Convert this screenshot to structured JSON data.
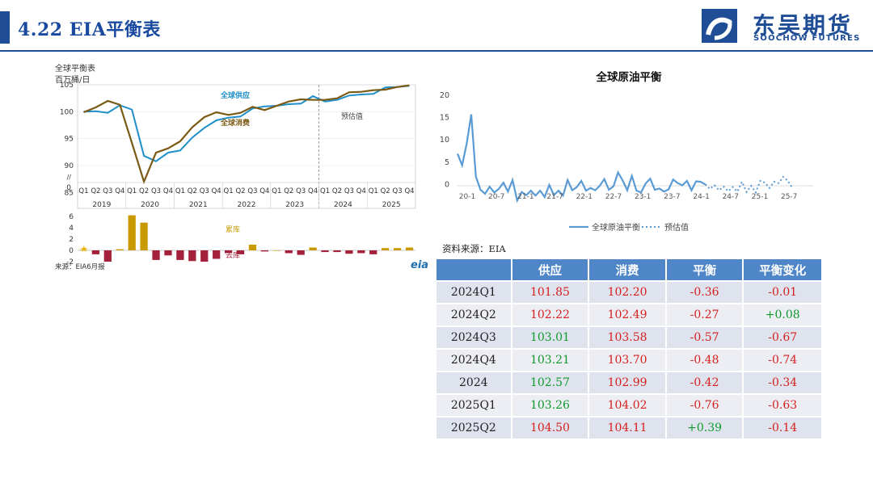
{
  "header": {
    "title": "4.22 EIA平衡表",
    "logo_cn": "东吴期货",
    "logo_en": "SOOCHOW FUTURES"
  },
  "colors": {
    "brand": "#1f4e96",
    "supply": "#1f8fc8",
    "consumption": "#7b5a14",
    "build": "#c99a00",
    "draw": "#a3213a",
    "balance_line": "#5b9bd5",
    "table_header": "#4e86c8",
    "positive": "#0f9a2e",
    "negative": "#d61f1f"
  },
  "left_chart": {
    "title": "全球平衡表",
    "unit": "百万桶/日",
    "supply_label": "全球供应",
    "consumption_label": "全球消费",
    "forecast_label": "预估值",
    "build_label": "累库",
    "draw_label": "去库",
    "source": "来源：EIA6月报",
    "eia_logo": "eia",
    "axis_break": "//",
    "quarters": [
      "Q1",
      "Q2",
      "Q3",
      "Q4",
      "Q1",
      "Q2",
      "Q3",
      "Q4",
      "Q1",
      "Q2",
      "Q3",
      "Q4",
      "Q1",
      "Q2",
      "Q3",
      "Q4",
      "Q1",
      "Q2",
      "Q3",
      "Q4",
      "Q1",
      "Q2",
      "Q3",
      "Q4",
      "Q1",
      "Q2",
      "Q3",
      "Q4"
    ],
    "years": [
      "2019",
      "2020",
      "2021",
      "2022",
      "2023",
      "2024",
      "2025"
    ],
    "y_ticks": [
      "105",
      "100",
      "95",
      "90",
      "85",
      "//",
      "0"
    ],
    "bar_ticks": [
      "6",
      "4",
      "2",
      "0",
      "-2"
    ]
  },
  "chart_data": [
    {
      "type": "line",
      "title": "全球平衡表",
      "ylabel": "百万桶/日",
      "ylim": [
        84,
        105
      ],
      "categories": [
        "2019Q1",
        "2019Q2",
        "2019Q3",
        "2019Q4",
        "2020Q1",
        "2020Q2",
        "2020Q3",
        "2020Q4",
        "2021Q1",
        "2021Q2",
        "2021Q3",
        "2021Q4",
        "2022Q1",
        "2022Q2",
        "2022Q3",
        "2022Q4",
        "2023Q1",
        "2023Q2",
        "2023Q3",
        "2023Q4",
        "2024Q1",
        "2024Q2",
        "2024Q3",
        "2024Q4",
        "2025Q1",
        "2025Q2",
        "2025Q3",
        "2025Q4"
      ],
      "series": [
        {
          "name": "全球供应",
          "values": [
            100.0,
            100.1,
            99.8,
            101.2,
            100.4,
            91.8,
            90.8,
            92.4,
            92.8,
            95.2,
            97.0,
            98.4,
            98.9,
            99.1,
            100.6,
            101.0,
            101.1,
            101.4,
            101.5,
            102.9,
            101.9,
            102.2,
            103.0,
            103.2,
            103.3,
            104.5,
            104.6,
            104.8
          ]
        },
        {
          "name": "全球消费",
          "values": [
            99.9,
            100.8,
            102.0,
            101.3,
            94.2,
            87.0,
            92.4,
            93.2,
            94.5,
            97.1,
            99.0,
            99.9,
            99.4,
            99.8,
            100.9,
            100.3,
            101.1,
            101.9,
            102.3,
            102.2,
            102.2,
            102.5,
            103.6,
            103.7,
            104.0,
            104.1,
            104.6,
            104.9
          ]
        }
      ],
      "forecast_start": "2024Q1"
    },
    {
      "type": "bar",
      "categories": [
        "2019Q1",
        "2019Q2",
        "2019Q3",
        "2019Q4",
        "2020Q1",
        "2020Q2",
        "2020Q3",
        "2020Q4",
        "2021Q1",
        "2021Q2",
        "2021Q3",
        "2021Q4",
        "2022Q1",
        "2022Q2",
        "2022Q3",
        "2022Q4",
        "2023Q1",
        "2023Q2",
        "2023Q3",
        "2023Q4",
        "2024Q1",
        "2024Q2",
        "2024Q3",
        "2024Q4",
        "2025Q1",
        "2025Q2",
        "2025Q3",
        "2025Q4"
      ],
      "values": [
        0.1,
        -0.7,
        -2.0,
        0.2,
        6.2,
        4.9,
        -1.7,
        -0.9,
        -1.7,
        -1.9,
        -2.0,
        -1.5,
        -0.5,
        -0.7,
        1.0,
        -0.2,
        0.0,
        -0.5,
        -0.8,
        0.5,
        -0.3,
        -0.3,
        -0.6,
        -0.5,
        -0.7,
        0.4,
        0.4,
        0.5
      ],
      "ylim": [
        -2,
        6
      ],
      "build_label": "累库",
      "draw_label": "去库"
    },
    {
      "type": "line",
      "title": "全球原油平衡",
      "ylim": [
        -5,
        20
      ],
      "y_ticks": [
        "20",
        "15",
        "10",
        "5",
        "0"
      ],
      "x_ticks": [
        "20-1",
        "20-7",
        "21-1",
        "21-7",
        "22-1",
        "22-7",
        "23-1",
        "23-7",
        "24-1",
        "24-7",
        "25-1",
        "25-7"
      ],
      "series": [
        {
          "name": "全球原油平衡",
          "values": [
            6.9,
            4.3,
            9.2,
            15.7,
            1.8,
            -1.2,
            -2.1,
            -0.5,
            -1.8,
            -1.0,
            0.4,
            -1.6,
            1.0,
            -3.6,
            -1.7,
            -2.4,
            -1.4,
            -2.5,
            -1.4,
            -2.8,
            -0.1,
            -2.4,
            -1.4,
            -2.5,
            1.0,
            -1.3,
            -0.6,
            0.8,
            -1.4,
            -0.8,
            -1.3,
            -0.3,
            1.2,
            -1.2,
            -0.4,
            2.7,
            0.9,
            -1.3,
            1.9,
            -1.4,
            -1.8,
            0.2,
            1.3,
            -1.2,
            -0.9,
            -1.6,
            -1.1,
            1.1,
            0.3,
            -0.2,
            0.8,
            -1.3,
            0.7,
            0.6,
            0.0
          ]
        },
        {
          "name": "预估值",
          "values": [
            0.0,
            -1.0,
            -0.2,
            -1.3,
            -0.5,
            -1.5,
            -0.6,
            -1.6,
            0.6,
            -1.7,
            -0.3,
            -1.8,
            0.8,
            0.4,
            -0.8,
            0.6,
            0.3,
            1.7,
            0.8,
            -0.8
          ]
        }
      ]
    }
  ],
  "right_chart": {
    "title": "全球原油平衡",
    "legend_actual": "全球原油平衡",
    "legend_forecast": "预估值",
    "source": "资料来源：EIA"
  },
  "table": {
    "headers": [
      "",
      "供应",
      "消费",
      "平衡",
      "平衡变化"
    ],
    "rows": [
      {
        "period": "2024Q1",
        "supply": "101.85",
        "consumption": "102.20",
        "balance": "-0.36",
        "change": "-0.01",
        "supply_color": "red",
        "change_color": "red"
      },
      {
        "period": "2024Q2",
        "supply": "102.22",
        "consumption": "102.49",
        "balance": "-0.27",
        "change": "+0.08",
        "supply_color": "red",
        "change_color": "green"
      },
      {
        "period": "2024Q3",
        "supply": "103.01",
        "consumption": "103.58",
        "balance": "-0.57",
        "change": "-0.67",
        "supply_color": "green",
        "change_color": "red"
      },
      {
        "period": "2024Q4",
        "supply": "103.21",
        "consumption": "103.70",
        "balance": "-0.48",
        "change": "-0.74",
        "supply_color": "green",
        "change_color": "red"
      },
      {
        "period": "2024",
        "supply": "102.57",
        "consumption": "102.99",
        "balance": "-0.42",
        "change": "-0.34",
        "supply_color": "green",
        "change_color": "red"
      },
      {
        "period": "2025Q1",
        "supply": "103.26",
        "consumption": "104.02",
        "balance": "-0.76",
        "change": "-0.63",
        "supply_color": "green",
        "change_color": "red"
      },
      {
        "period": "2025Q2",
        "supply": "104.50",
        "consumption": "104.11",
        "balance": "+0.39",
        "change": "-0.14",
        "supply_color": "red",
        "change_color": "red"
      }
    ]
  }
}
